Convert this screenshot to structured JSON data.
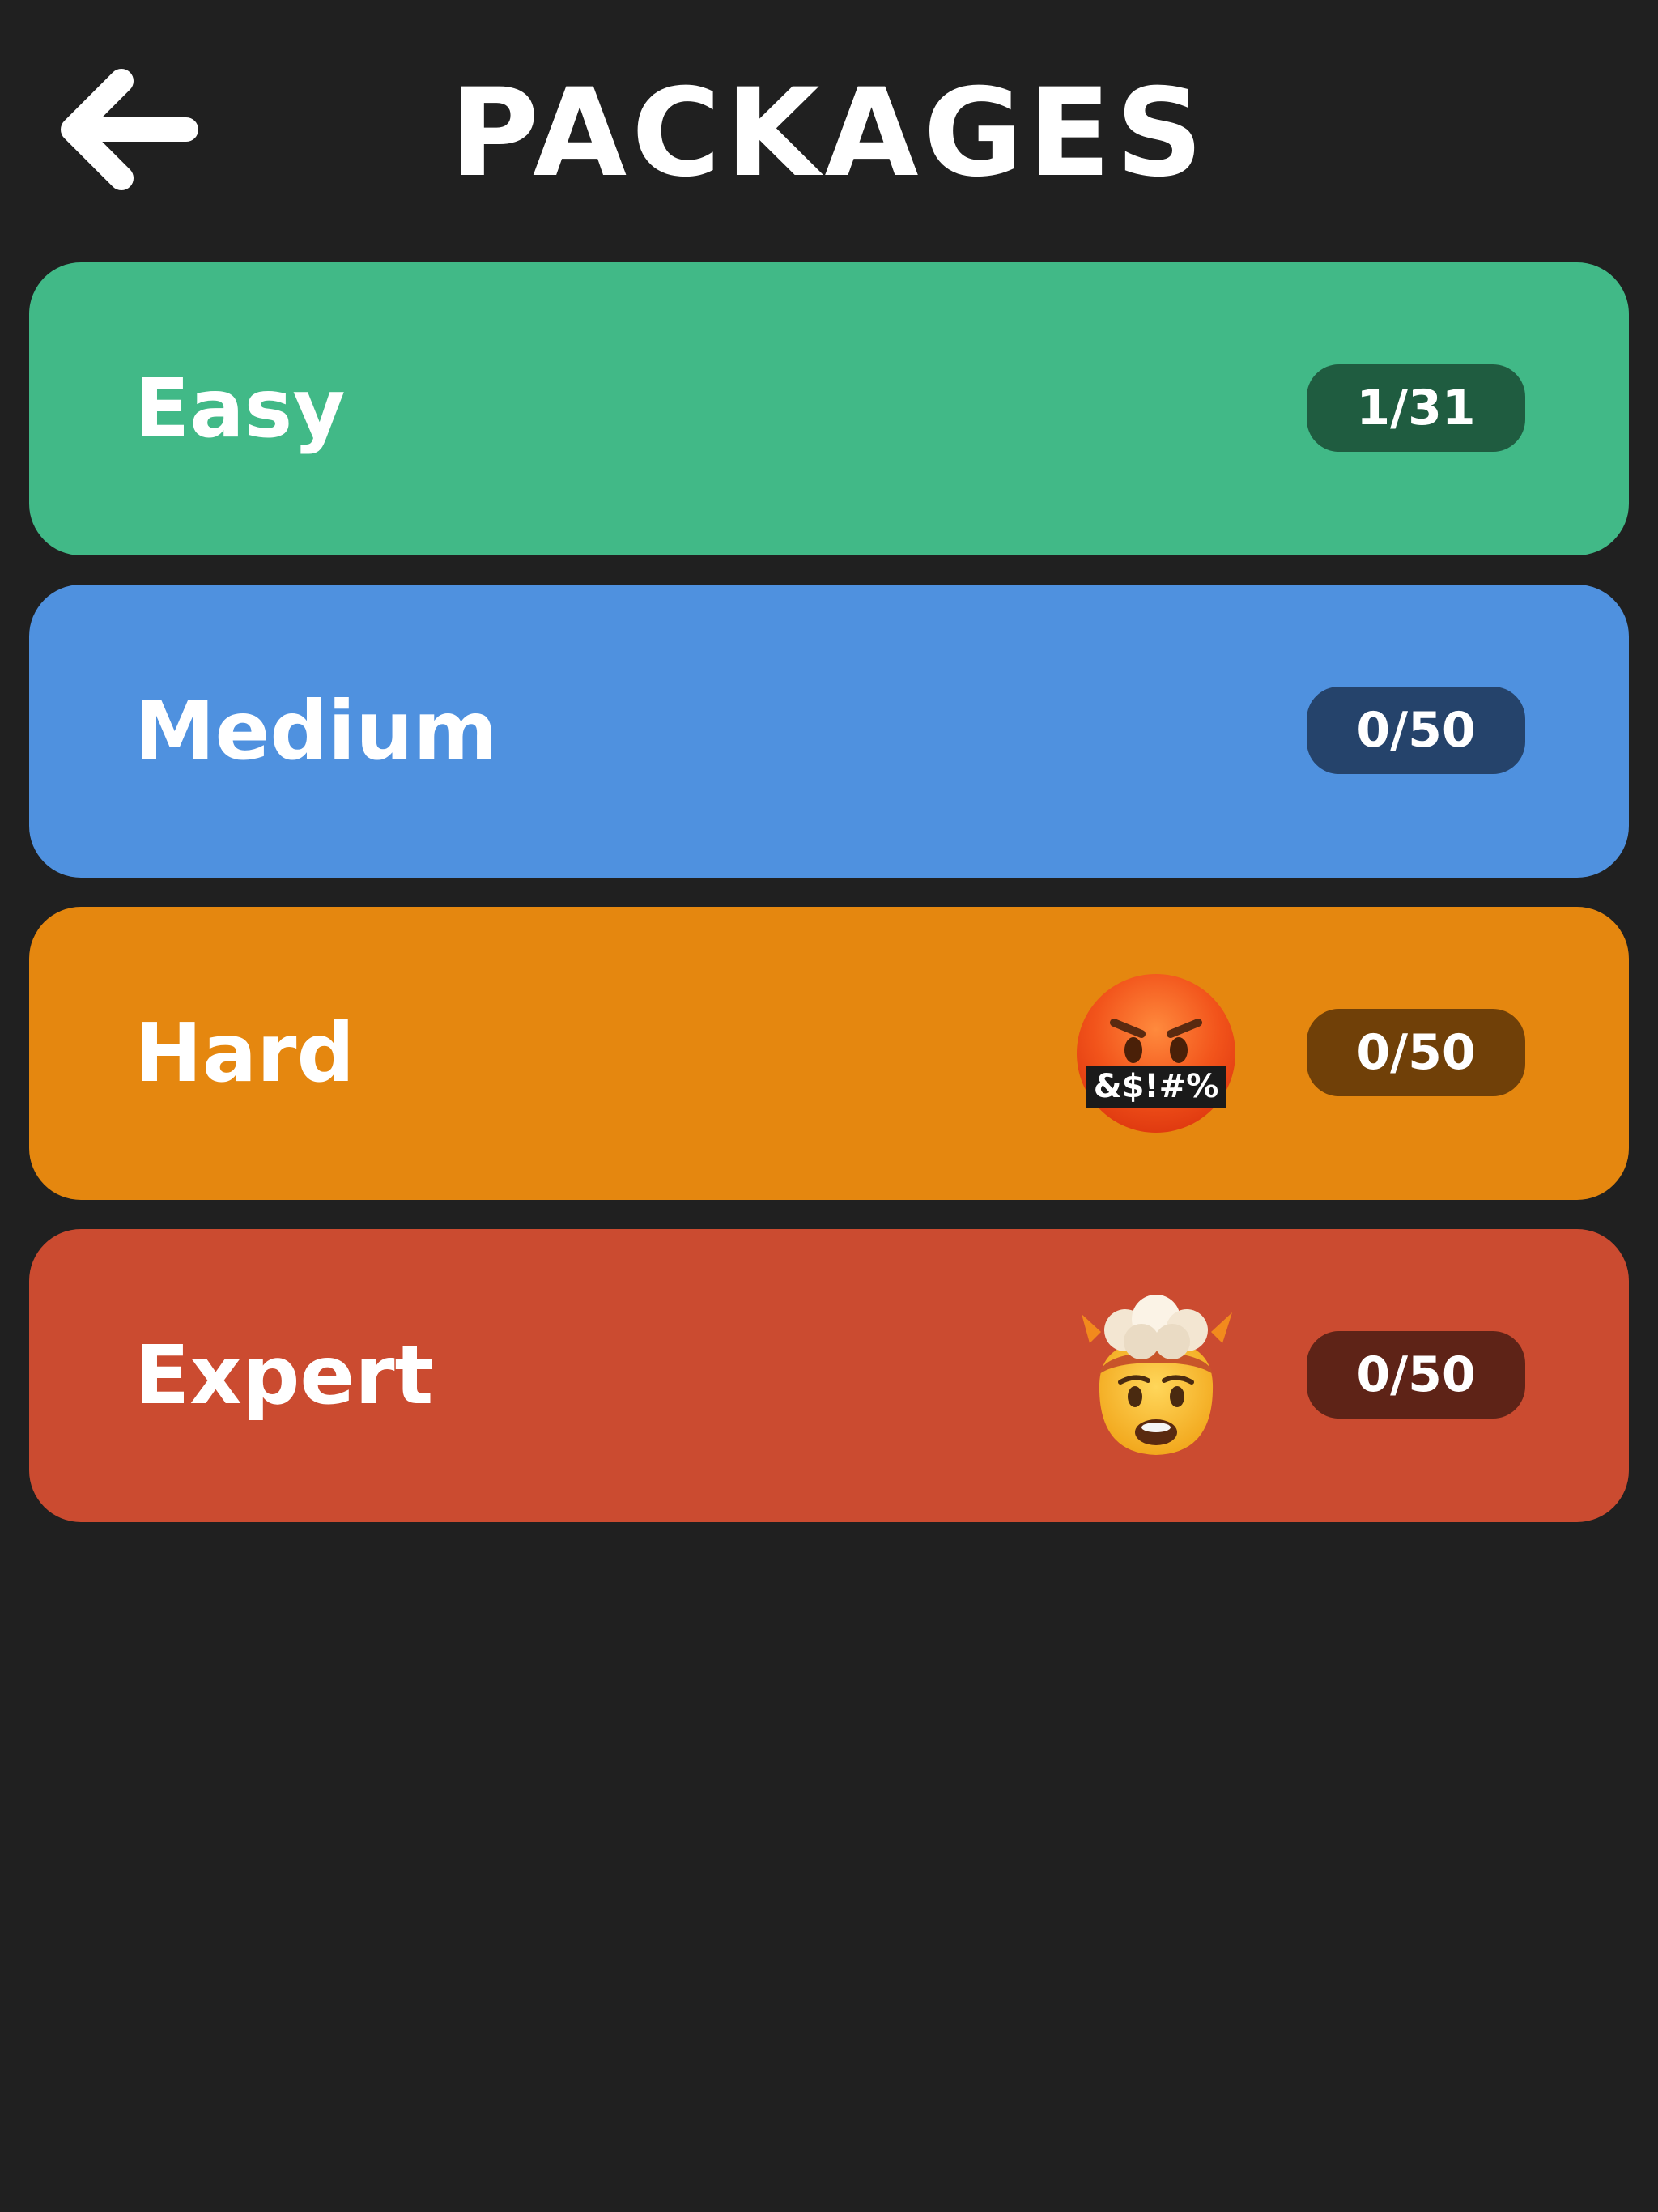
{
  "header": {
    "title": "PACKAGES",
    "back_icon": "arrow-left-icon"
  },
  "packages": [
    {
      "name": "Easy",
      "progress": "1/31",
      "completed": 1,
      "total": 31,
      "color": "#41B987",
      "badge_color": "#1F5C40",
      "emoji": null
    },
    {
      "name": "Medium",
      "progress": "0/50",
      "completed": 0,
      "total": 50,
      "color": "#4F91DF",
      "badge_color": "#25436B",
      "emoji": null
    },
    {
      "name": "Hard",
      "progress": "0/50",
      "completed": 0,
      "total": 50,
      "color": "#E5870F",
      "badge_color": "#704008",
      "emoji": "face-with-symbols-on-mouth-icon",
      "emoji_text": "&$!#%"
    },
    {
      "name": "Expert",
      "progress": "0/50",
      "completed": 0,
      "total": 50,
      "color": "#CB4B30",
      "badge_color": "#5E2317",
      "emoji": "exploding-head-icon"
    }
  ]
}
